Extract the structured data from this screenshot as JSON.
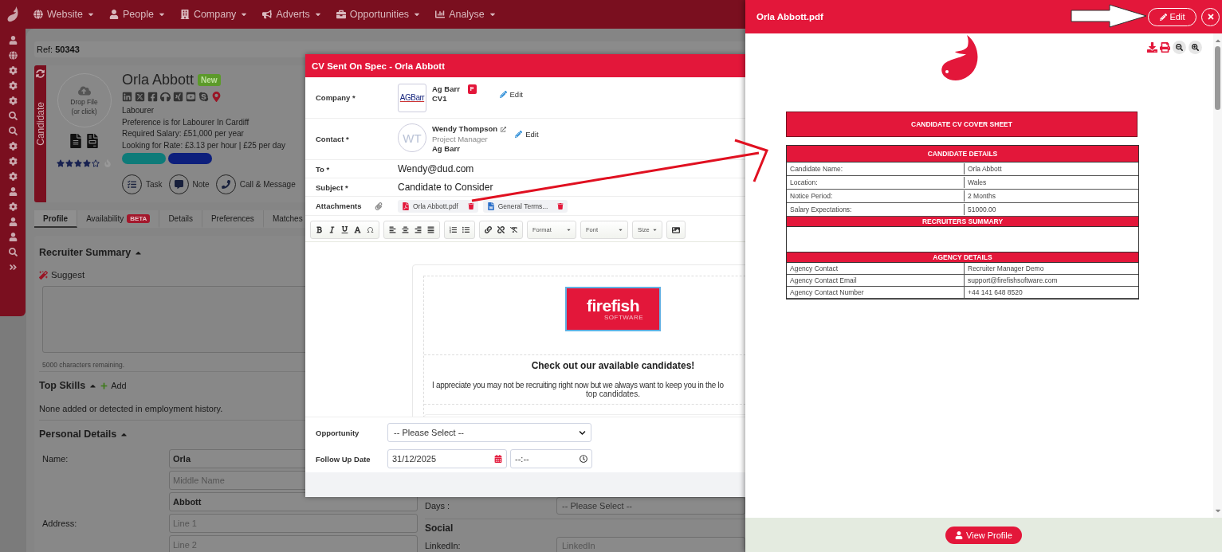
{
  "nav": {
    "items": [
      "Website",
      "People",
      "Company",
      "Adverts",
      "Opportunities",
      "Analyse"
    ]
  },
  "ref": {
    "label": "Ref:",
    "value": "50343"
  },
  "candidate": {
    "side_tab": "Candidate",
    "drop_label": "Drop File",
    "drop_hint": "(or click)",
    "stars": 4,
    "name": "Orla Abbott",
    "badge": "New",
    "lines": [
      "Labourer",
      "Preference is for Labourer In Cardiff",
      "Required Salary: £51,000 per year",
      "Looking for Rate: £3.13 per hour | £25 per day"
    ],
    "tags": [
      {
        "color": "#0e7b79"
      },
      {
        "color": "#0d1f7c"
      }
    ],
    "actions": [
      "Task",
      "Note",
      "Call & Message"
    ]
  },
  "tabs": [
    {
      "label": "Profile",
      "selected": true
    },
    {
      "label": "Availability",
      "badge": "BETA",
      "selected": false
    },
    {
      "label": "Details",
      "selected": false
    },
    {
      "label": "Preferences",
      "selected": false
    },
    {
      "label": "Matches",
      "selected": false
    }
  ],
  "profile": {
    "summary_title": "Recruiter Summary",
    "suggest": "Suggest",
    "chars_remaining": "5000 characters remaining.",
    "skills_title": "Top Skills",
    "add": "Add",
    "skills_empty": "None added or detected in employment history.",
    "personal_title": "Personal Details",
    "fields": [
      {
        "label": "Name:",
        "value": "Orla"
      },
      {
        "placeholder": "Middle Name"
      },
      {
        "value": "Abbott"
      },
      {
        "label": "Address:",
        "placeholder": "Line 1"
      },
      {
        "placeholder": "Line 2"
      }
    ],
    "days_label": "Days :",
    "days_select": "-- Please Select --",
    "social_title": "Social",
    "linkedin_label": "LinkedIn:",
    "linkedin_placeholder": "LinkedIn"
  },
  "modal": {
    "title": "CV Sent On Spec - Orla Abbott",
    "company": {
      "label": "Company *",
      "logo_text": "AGBarr",
      "name": "Ag Barr",
      "badge": "P",
      "sub": "CV1",
      "edit": "Edit"
    },
    "contact": {
      "label": "Contact *",
      "initials": "WT",
      "name": "Wendy Thompson",
      "role": "Project Manager",
      "company": "Ag Barr",
      "edit": "Edit"
    },
    "to": {
      "label": "To *",
      "value": "Wendy@dud.com"
    },
    "subject": {
      "label": "Subject *",
      "value": "Candidate to Consider"
    },
    "attachments": {
      "label": "Attachments",
      "files": [
        {
          "kind": "pdf",
          "name": "Orla Abbott.pdf"
        },
        {
          "kind": "word",
          "name": "General Terms..."
        }
      ]
    },
    "toolbar": {
      "dropdowns": [
        "Format",
        "Font",
        "Size"
      ]
    },
    "email": {
      "logo_text": "firefish",
      "logo_subtext": "SOFTWARE",
      "heading": "Check out our available candidates!",
      "line_1": "I appreciate you may not be recruiting right now but we always want to keep you in the lo",
      "line_2": "top candidates."
    },
    "opportunity": {
      "label": "Opportunity",
      "value": "-- Please Select --"
    },
    "follow_up": {
      "label": "Follow Up Date",
      "date": "31/12/2025",
      "time": "--:--"
    }
  },
  "pdf_panel": {
    "title": "Orla Abbott.pdf",
    "edit": "Edit",
    "cover_title": "CANDIDATE CV COVER SHEET",
    "sections": [
      {
        "kind": "table",
        "title": "CANDIDATE DETAILS",
        "rows": [
          {
            "label": "Candidate Name:",
            "value": "Orla Abbott"
          },
          {
            "label": "Location:",
            "value": "Wales"
          },
          {
            "label": "Notice Period:",
            "value": "2 Months"
          },
          {
            "label": "Salary Expectations:",
            "value": "51000.00"
          }
        ]
      },
      {
        "kind": "blank",
        "title": "RECRUITERS SUMMARY"
      },
      {
        "kind": "table",
        "title": "AGENCY DETAILS",
        "rows": [
          {
            "label": "Agency Contact",
            "value": "Recruiter Manager Demo"
          },
          {
            "label": "Agency Contact Email",
            "value": "support@firefishsoftware.com"
          },
          {
            "label": "Agency Contact Number",
            "value": "+44 141 648 8520"
          }
        ]
      }
    ],
    "view_profile": "View Profile"
  }
}
